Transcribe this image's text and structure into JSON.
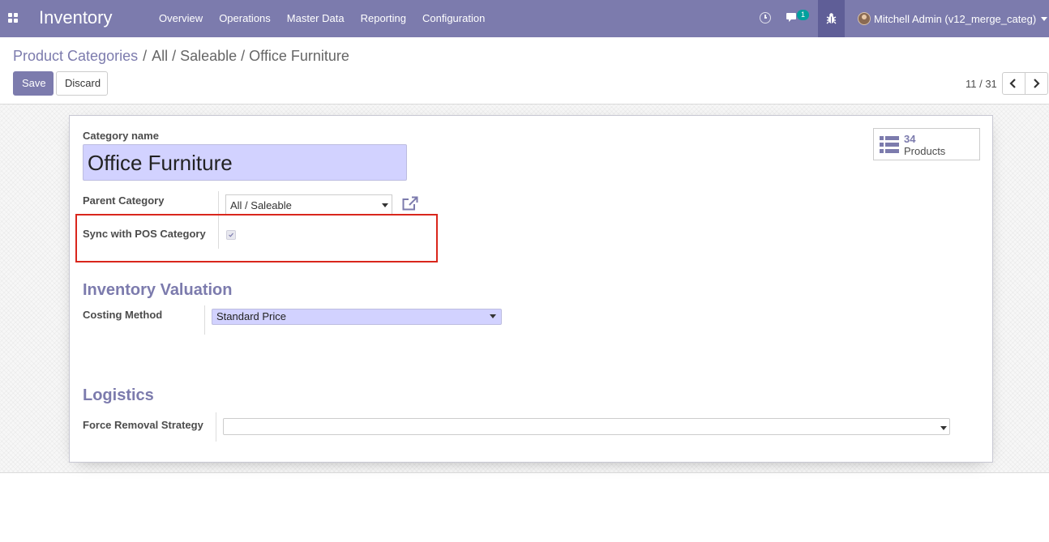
{
  "navbar": {
    "app_name": "Inventory",
    "menu": [
      "Overview",
      "Operations",
      "Master Data",
      "Reporting",
      "Configuration"
    ],
    "chat_count": "1",
    "user_name": "Mitchell Admin (v12_merge_categ)",
    "color": "#7c7bad",
    "icons": [
      "apps-icon",
      "clock-icon",
      "chat-icon",
      "bug-icon",
      "avatar"
    ]
  },
  "breadcrumb": {
    "root": "Product Categories",
    "separator": "/",
    "current": "All / Saleable / Office Furniture"
  },
  "buttons": {
    "save": "Save",
    "discard": "Discard"
  },
  "pager": {
    "value": "11 / 31"
  },
  "form": {
    "category_name_label": "Category name",
    "category_name": "Office Furniture",
    "parent_category_label": "Parent Category",
    "parent_category": "All / Saleable",
    "sync_pos_label": "Sync with POS Category",
    "sync_pos_checked": true,
    "stat": {
      "count": "34",
      "label": "Products"
    },
    "inventory_valuation_title": "Inventory Valuation",
    "costing_method_label": "Costing Method",
    "costing_method": "Standard Price",
    "logistics_title": "Logistics",
    "removal_strategy_label": "Force Removal Strategy",
    "removal_strategy": ""
  },
  "colors": {
    "accent": "#7c7bad",
    "required_field": "#d2d2ff",
    "highlight": "#d9261c"
  }
}
